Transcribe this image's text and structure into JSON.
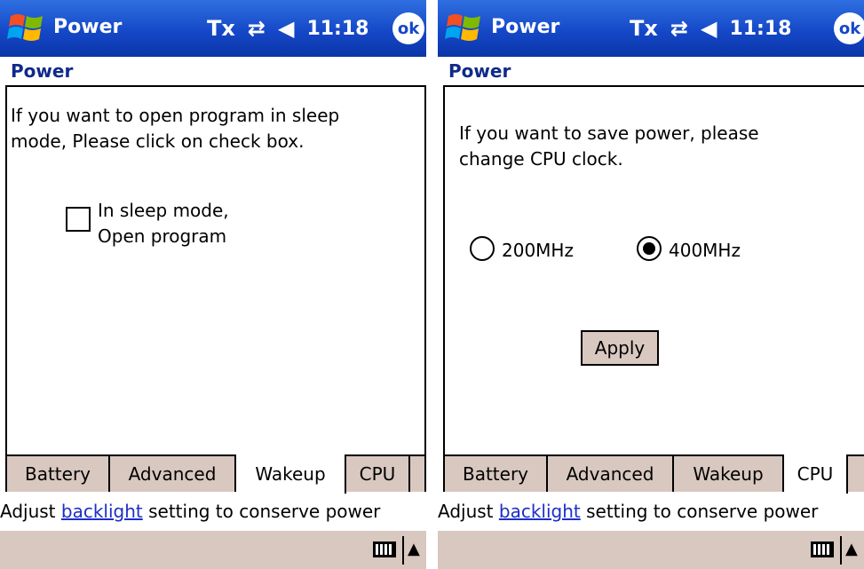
{
  "screens": [
    {
      "title": "Power",
      "status": {
        "signal": "Tx",
        "sync": "⇄",
        "volume": "◀",
        "time": "11:18"
      },
      "ok": "ok",
      "heading": "Power",
      "intro": "If you want to open program in sleep mode, Please click on check box.",
      "checkbox_label": "In sleep mode, Open program",
      "tabs": [
        "Battery",
        "Advanced",
        "Wakeup",
        "CPU"
      ],
      "active_tab": "Wakeup",
      "footer": {
        "pre": "Adjust ",
        "link": "backlight",
        "post": " setting to conserve power"
      }
    },
    {
      "title": "Power",
      "status": {
        "signal": "Tx",
        "sync": "⇄",
        "volume": "◀",
        "time": "11:18"
      },
      "ok": "ok",
      "heading": "Power",
      "intro": "If you want to save power, please change CPU clock.",
      "radio_200": "200MHz",
      "radio_400": "400MHz",
      "selected_clock": "400MHz",
      "apply_label": "Apply",
      "tabs": [
        "Battery",
        "Advanced",
        "Wakeup",
        "CPU"
      ],
      "active_tab": "CPU",
      "footer": {
        "pre": "Adjust ",
        "link": "backlight",
        "post": " setting to conserve power"
      }
    }
  ]
}
